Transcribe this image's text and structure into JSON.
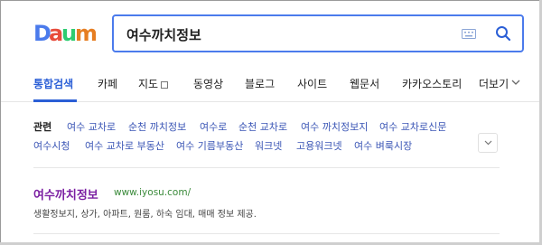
{
  "logo": {
    "text": "Daum",
    "colors": [
      "#4b7bec",
      "#e74c3c",
      "#f1c40f",
      "#2ecc71",
      "#e67e22"
    ]
  },
  "search": {
    "query": "여수까치정보"
  },
  "tabs": [
    {
      "label": "통합검색",
      "active": true
    },
    {
      "label": "카페"
    },
    {
      "label": "지도"
    },
    {
      "label": "동영상"
    },
    {
      "label": "블로그"
    },
    {
      "label": "사이트"
    },
    {
      "label": "웹문서"
    },
    {
      "label": "카카오스토리"
    },
    {
      "label": "더보기"
    }
  ],
  "related": {
    "label": "관련",
    "row1": [
      "여수 교차로",
      "순천 까치정보",
      "여수로",
      "순천 교차로",
      "여수 까치정보지",
      "여수 교차로신문"
    ],
    "row2": [
      "여수시청",
      "여수 교차로 부동산",
      "여수 기름부동산",
      "워크넷",
      "고용워크넷",
      "여수 벼룩시장"
    ]
  },
  "result": {
    "title": "여수까치정보",
    "url": "www.iyosu.com/",
    "description": "생활정보지, 상가, 아파트, 원룸, 하숙 임대, 매매 정보 제공."
  }
}
